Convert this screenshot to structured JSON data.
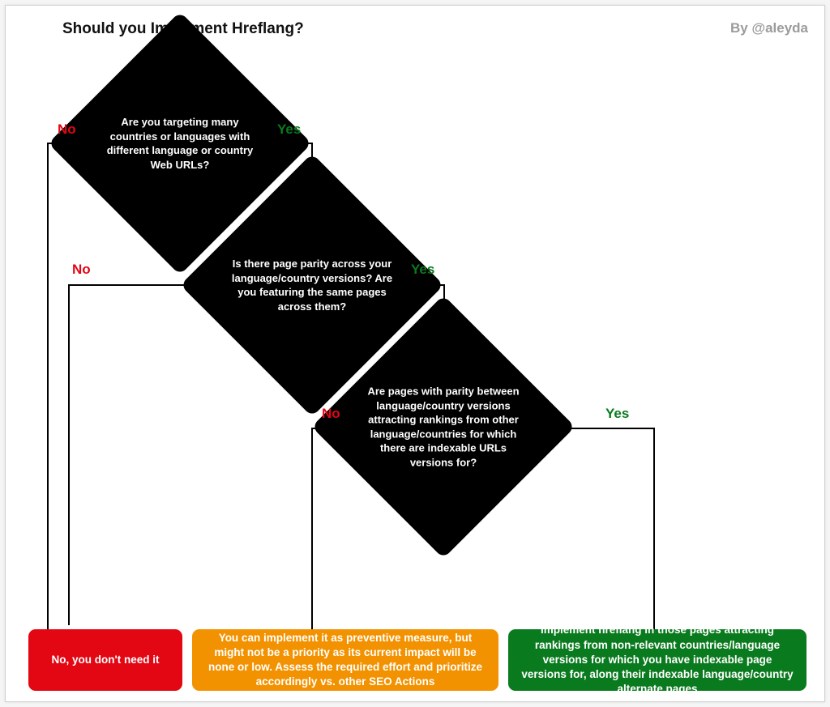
{
  "title": "Should you Implement Hreflang?",
  "byline": "By @aleyda",
  "labels": {
    "yes": "Yes",
    "no": "No"
  },
  "nodes": {
    "q1": "Are you targeting many countries or languages with different language or country Web URLs?",
    "q2": "Is there page parity across your language/country versions? Are you featuring the same pages across them?",
    "q3": "Are pages with parity between language/country versions attracting rankings from other language/countries for which there are indexable URLs versions for?"
  },
  "results": {
    "r1": "No, you don't need it",
    "r2": "You can implement it as preventive measure, but might not be a priority as its current impact will be none or low. Assess the required effort and prioritize accordingly vs. other SEO Actions",
    "r3": "Implement hreflang in those pages attracting rankings from non-relevant countries/language versions for which you have indexable page versions for, along their indexable language/country alternate pages"
  },
  "chart_data": {
    "type": "flowchart",
    "start": "q1",
    "nodes": [
      {
        "id": "q1",
        "type": "decision",
        "text_ref": "nodes.q1",
        "yes": "q2",
        "no": "r1"
      },
      {
        "id": "q2",
        "type": "decision",
        "text_ref": "nodes.q2",
        "yes": "q3",
        "no": "r1"
      },
      {
        "id": "q3",
        "type": "decision",
        "text_ref": "nodes.q3",
        "yes": "r3",
        "no": "r2"
      },
      {
        "id": "r1",
        "type": "terminal",
        "color": "red",
        "text_ref": "results.r1"
      },
      {
        "id": "r2",
        "type": "terminal",
        "color": "orange",
        "text_ref": "results.r2"
      },
      {
        "id": "r3",
        "type": "terminal",
        "color": "green",
        "text_ref": "results.r3"
      }
    ]
  }
}
